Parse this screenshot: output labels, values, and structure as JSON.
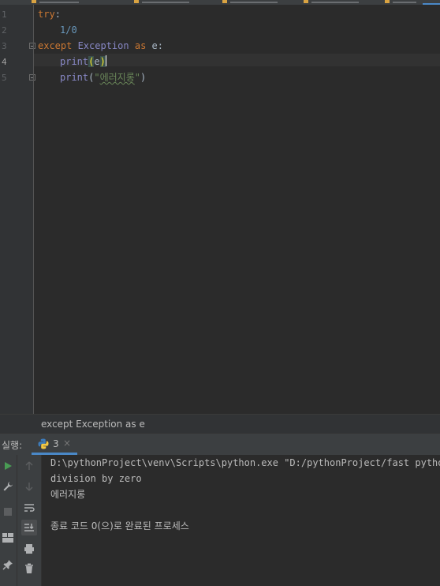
{
  "editor": {
    "line_numbers": [
      "1",
      "2",
      "3",
      "4",
      "5"
    ],
    "line1": {
      "kw": "try",
      "colon": ":"
    },
    "line2": {
      "num": "1/0"
    },
    "line3": {
      "kw_except": "except",
      "cls": " Exception ",
      "kw_as": "as",
      "rest": " e:"
    },
    "line4": {
      "fn": "print",
      "open": "(",
      "arg": "e",
      "close": ")"
    },
    "line5": {
      "fn": "print",
      "open": "(",
      "q1": "\"",
      "str": "에러지롱",
      "q2": "\"",
      "close": ")"
    }
  },
  "breadcrumb": {
    "text": "except Exception as e"
  },
  "run_panel": {
    "label": "실행:",
    "tab_label": "3",
    "tab_close": "×",
    "output_lines": [
      "D:\\pythonProject\\venv\\Scripts\\python.exe \"D:/pythonProject/fast python/",
      "division by zero",
      "에러지롱",
      "",
      "종료 코드 0(으)로 완료된 프로세스"
    ]
  },
  "icons": {
    "run": "run-icon",
    "wrench": "wrench-icon",
    "stop": "stop-icon",
    "layout": "layout-icon",
    "pin": "pin-icon",
    "up": "arrow-up-icon",
    "down": "arrow-down-icon",
    "wrap": "soft-wrap-icon",
    "scroll_end": "scroll-to-end-icon",
    "print": "print-icon",
    "trash": "trash-icon",
    "python": "python-icon"
  },
  "colors": {
    "background": "#2b2b2b",
    "keyword": "#cc7832",
    "number": "#6897bb",
    "builtin": "#8888c6",
    "string": "#6a8759",
    "accent": "#4a88c7",
    "run_green": "#499c54"
  }
}
